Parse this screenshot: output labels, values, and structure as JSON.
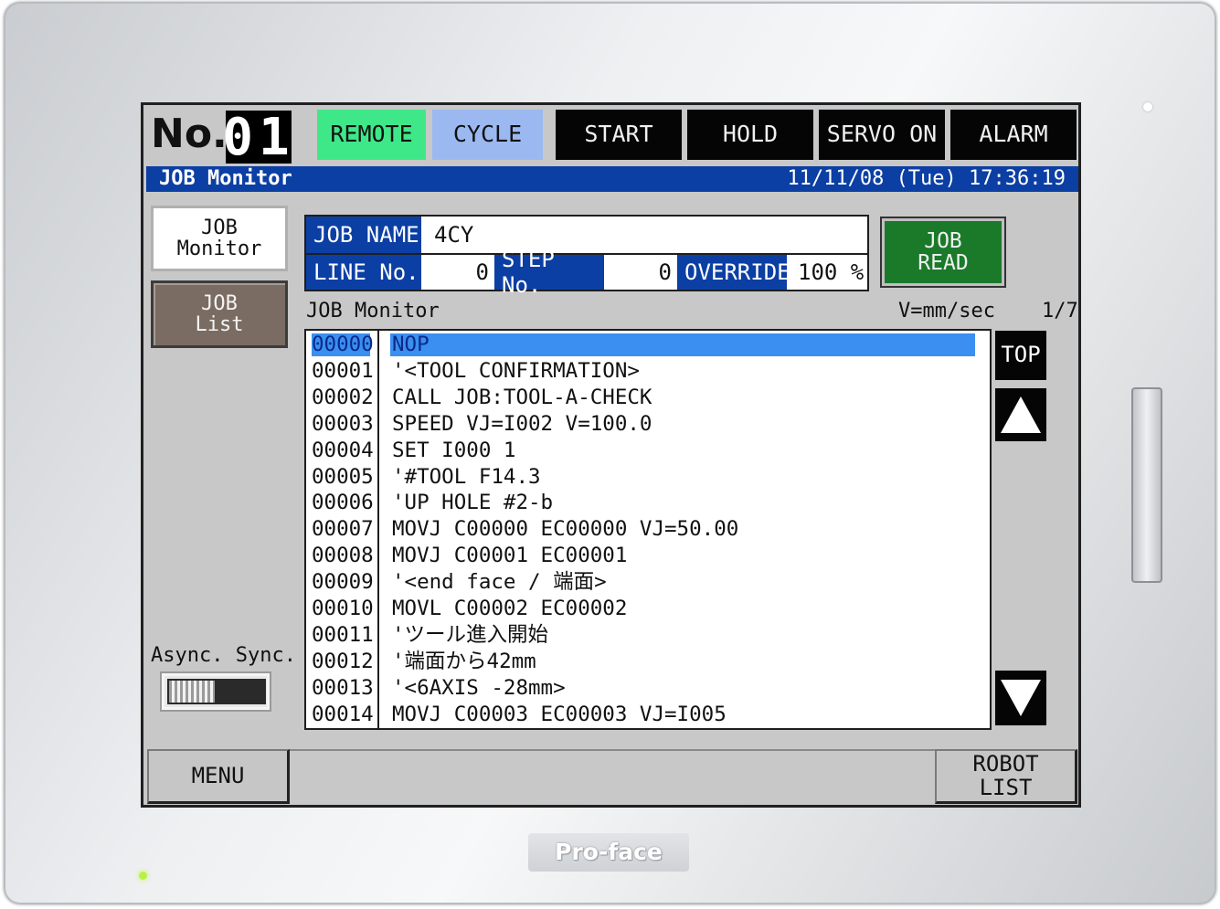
{
  "header": {
    "no_label": "No.",
    "no_value": "01",
    "buttons": [
      {
        "label": "REMOTE"
      },
      {
        "label": "CYCLE"
      },
      {
        "label": "START"
      },
      {
        "label": "HOLD"
      },
      {
        "label": "SERVO ON"
      },
      {
        "label": "ALARM"
      }
    ]
  },
  "titlebar": {
    "title": "JOB Monitor",
    "datetime": "11/11/08 (Tue) 17:36:19"
  },
  "sidebar": {
    "job_monitor": "JOB\nMonitor",
    "job_list": "JOB\nList",
    "async_sync_label": "Async. Sync."
  },
  "info": {
    "job_name_label": "JOB NAME",
    "job_name_value": "4CY",
    "line_no_label": "LINE No.",
    "line_no_value": "0",
    "step_no_label": "STEP No.",
    "step_no_value": "0",
    "override_label": "OVERRIDE",
    "override_value": "100 %"
  },
  "job_read_button": "JOB\nREAD",
  "monitor": {
    "title": "JOB Monitor",
    "unit": "V=mm/sec",
    "page": "1/7",
    "selected_index": 0,
    "rows": [
      {
        "line": "00000",
        "cmd": "NOP"
      },
      {
        "line": "00001",
        "cmd": "'<TOOL CONFIRMATION>"
      },
      {
        "line": "00002",
        "cmd": "CALL JOB:TOOL-A-CHECK"
      },
      {
        "line": "00003",
        "cmd": "SPEED VJ=I002 V=100.0"
      },
      {
        "line": "00004",
        "cmd": "SET I000 1"
      },
      {
        "line": "00005",
        "cmd": "'#TOOL F14.3"
      },
      {
        "line": "00006",
        "cmd": "'UP HOLE #2-b"
      },
      {
        "line": "00007",
        "cmd": "MOVJ C00000 EC00000 VJ=50.00"
      },
      {
        "line": "00008",
        "cmd": "MOVJ C00001 EC00001"
      },
      {
        "line": "00009",
        "cmd": "'<end face / 端面>"
      },
      {
        "line": "00010",
        "cmd": "MOVL C00002 EC00002"
      },
      {
        "line": "00011",
        "cmd": "'ツール進入開始"
      },
      {
        "line": "00012",
        "cmd": "'端面から42mm"
      },
      {
        "line": "00013",
        "cmd": "'<6AXIS -28mm>"
      },
      {
        "line": "00014",
        "cmd": "MOVJ C00003 EC00003 VJ=I005"
      }
    ],
    "top_button": "TOP",
    "up_icon": "triangle-up-icon",
    "down_icon": "triangle-down-icon"
  },
  "footer": {
    "menu": "MENU",
    "robot_list": "ROBOT\nLIST"
  },
  "bezel": {
    "brand": "Pro-face"
  },
  "colors": {
    "remote": "#3ee889",
    "cycle": "#9bb9f0",
    "titlebar": "#0c3fa4",
    "selection": "#3a8ff0",
    "job_read": "#1a7a2a"
  }
}
